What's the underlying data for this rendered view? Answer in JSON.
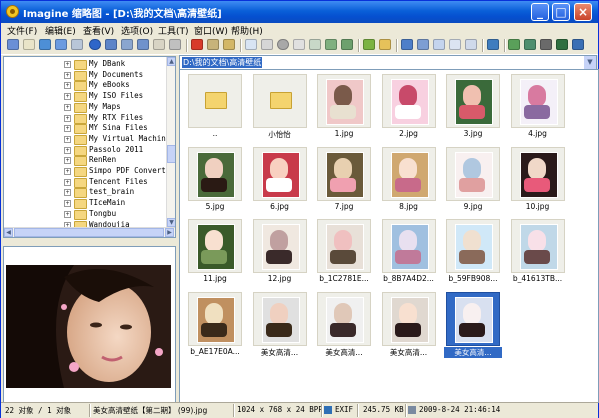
{
  "window": {
    "title": "Imagine 缩略图 - [D:\\我的文档\\高清壁纸]"
  },
  "menubar": [
    "文件(F)",
    "编辑(E)",
    "查看(V)",
    "选项(O)",
    "工具(T)",
    "窗口(W)",
    "帮助(H)"
  ],
  "tree": {
    "items": [
      "My DBank",
      "My Documents",
      "My eBooks",
      "My ISO Files",
      "My Maps",
      "My RTX Files",
      "MY Sina Files",
      "My Virtual Machines",
      "Passolo 2011",
      "RenRen",
      "Simpo PDF Converter",
      "Tencent Files",
      "test_brain",
      "TIceMain",
      "Tongbu",
      "Wandoujia"
    ]
  },
  "pathbar": {
    "path": "D:\\我的文档\\高清壁纸"
  },
  "thumbnails": [
    {
      "label": "..",
      "kind": "folder"
    },
    {
      "label": "小怡怡",
      "kind": "folder"
    },
    {
      "label": "1.jpg"
    },
    {
      "label": "2.jpg"
    },
    {
      "label": "3.jpg"
    },
    {
      "label": "4.jpg"
    },
    {
      "label": "5.jpg"
    },
    {
      "label": "6.jpg"
    },
    {
      "label": "7.jpg"
    },
    {
      "label": "8.jpg"
    },
    {
      "label": "9.jpg"
    },
    {
      "label": "10.jpg"
    },
    {
      "label": "11.jpg"
    },
    {
      "label": "12.jpg"
    },
    {
      "label": "b_1C2781E..."
    },
    {
      "label": "b_8B7A4D2..."
    },
    {
      "label": "b_59FB908..."
    },
    {
      "label": "b_41613TB..."
    },
    {
      "label": "b_AE17E0A..."
    },
    {
      "label": "美女高清..."
    },
    {
      "label": "美女高清..."
    },
    {
      "label": "美女高清..."
    },
    {
      "label": "美女高清...",
      "selected": true
    }
  ],
  "status": {
    "count": "22 对象 / 1 对象",
    "name": "美女高清壁纸【第二期】 (99).jpg",
    "dims": "1024 x 768 x 24 BPP",
    "exif": "EXIF",
    "size": "245.75 KB",
    "date": "2009-8-24 21:46:14"
  },
  "colors": {
    "title_bar": "#0a5fd8",
    "selection": "#316ac5"
  }
}
